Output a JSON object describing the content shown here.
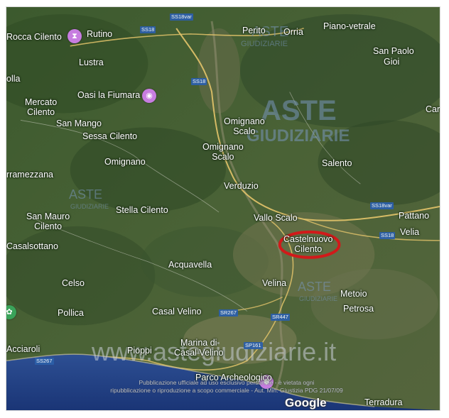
{
  "map": {
    "places": {
      "rocca_cilento": "Rocca Cilento",
      "rutino": "Rutino",
      "perito": "Perito",
      "orria": "Orria",
      "piano_vetrale": "Piano-vetrale",
      "lustra": "Lustra",
      "san_paolo": "San Paolo",
      "gioi": "Gioi",
      "olla": "olla",
      "oasi": "Oasi la Fiumara",
      "mercato_cilento": "Mercato\nCilento",
      "car": "Car",
      "san_mango": "San Mango",
      "omignano_scalo_1": "Omignano\nScalo",
      "sessa_cilento": "Sessa Cilento",
      "omignano_scalo_2": "Omignano\nScalo",
      "omignano": "Omignano",
      "salento": "Salento",
      "rramezzana": "rramezzana",
      "verduzio": "Verduzio",
      "stella_cilento": "Stella Cilento",
      "san_mauro_cilento": "San Mauro\nCilento",
      "vallo_scalo": "Vallo Scalo",
      "pattano": "Pattano",
      "velia": "Velia",
      "castelnuovo_cilento": "Castelnuovo\nCilento",
      "casalsottano": "Casalsottano",
      "acquavella": "Acquavella",
      "celso": "Celso",
      "velina": "Velina",
      "metoio": "Metoio",
      "pollica": "Pollica",
      "casal_velino": "Casal Velino",
      "petrosa": "Petrosa",
      "marina_di_casal_velino": "Marina di\nCasal Velino",
      "acciaroli": "Acciaroli",
      "pioppi": "Pioppi",
      "parco_archeologico": "Parco Archeologico",
      "terradura": "Terradura"
    },
    "roads": {
      "ss18var_top": "SS18var",
      "ss18_top": "SS18",
      "ss18_mid": "SS18",
      "ss18var_right": "SS18var",
      "ss18_right": "SS18",
      "sr267_mid": "SR267",
      "sr447": "SR447",
      "sp161": "SP161",
      "ss267_left": "SS267"
    },
    "watermarks": {
      "aste_top": "ASTE",
      "giudiziarie_top": "GIUDIZIARIE",
      "aste_center": "ASTE",
      "giudiziarie_center": "GIUDIZIARIE",
      "aste_left": "ASTE",
      "giudiziarie_left": "GIUDIZIARIE",
      "aste_right": "ASTE",
      "giudiziarie_right": "GIUDIZIARIE",
      "site": "www.astegiudiziarie.it"
    },
    "notice": {
      "line1": "Pubblicazione ufficiale ad uso esclusivo personale - è vietata ogni",
      "line2": "ripubblicazione o riproduzione a scopo commerciale - Aut. Min. Giustizia PDG 21/07/09"
    },
    "logo": "Google",
    "colors": {
      "marker_circle": "#d11a1a",
      "pin_purple": "#c77de0",
      "road_label": "#2c5fa8",
      "sea": "#1e3f86"
    }
  }
}
